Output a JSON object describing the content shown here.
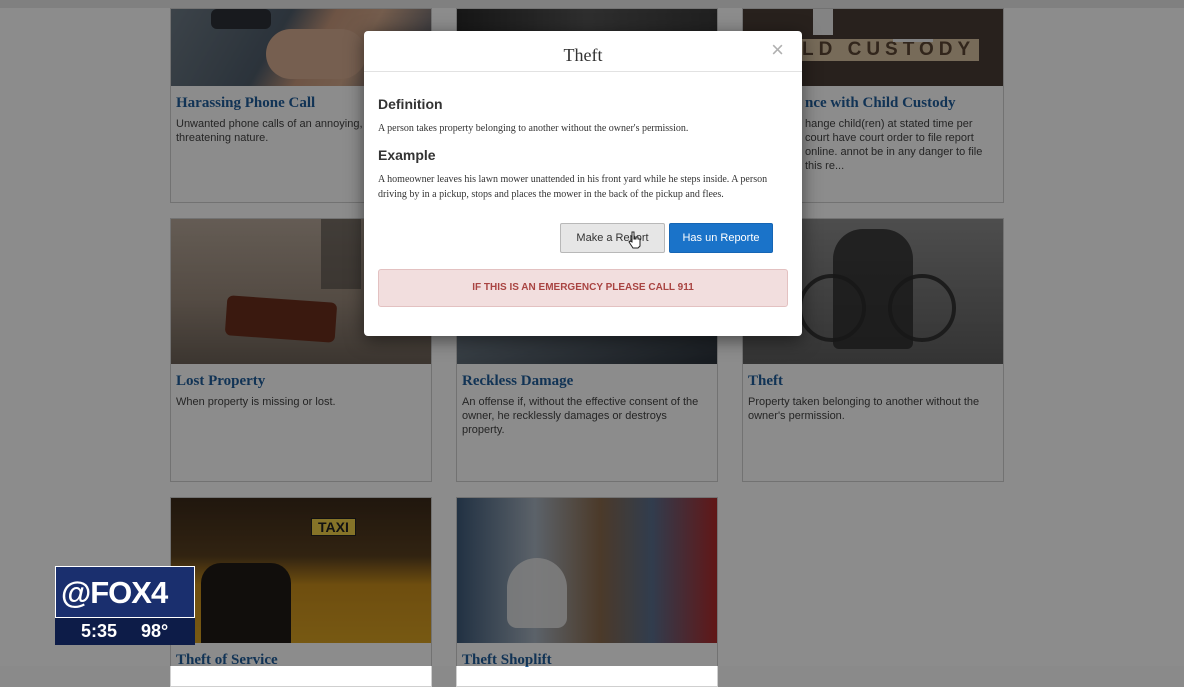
{
  "cards": [
    {
      "title": "Harassing Phone Call",
      "desc": "Unwanted phone calls of an annoying, h threatening nature."
    },
    {
      "title": "",
      "desc": ""
    },
    {
      "title": "nce with Child Custody",
      "desc": "hange child(ren) at stated time per court have court order to file report online. annot be in any danger to file this re..."
    },
    {
      "title": "Lost Property",
      "desc": "When property is missing or lost."
    },
    {
      "title": "Reckless Damage",
      "desc": "An offense if, without the effective consent of the owner, he recklessly damages or destroys property."
    },
    {
      "title": "Theft",
      "desc": "Property taken belonging to another without the owner's permission."
    },
    {
      "title": "Theft of Service",
      "desc": ""
    },
    {
      "title": "Theft Shoplift",
      "desc": ""
    }
  ],
  "image_text": {
    "custody_banner": "LD CUSTODY",
    "taxi_sign": "TAXI"
  },
  "modal": {
    "title": "Theft",
    "close": "×",
    "definition_heading": "Definition",
    "definition_text": "A person takes property belonging to another without the owner's permission.",
    "example_heading": "Example",
    "example_text": "A homeowner leaves his lawn mower unattended in his front yard while he steps inside. A person driving by in a pickup, stops and places the mower in the back of the pickup and flees.",
    "report_button": "Make a Report",
    "spanish_button": "Has un Reporte",
    "emergency_notice": "IF THIS IS AN EMERGENCY PLEASE CALL 911"
  },
  "badge": {
    "logo": "@FOX4",
    "time": "5:35",
    "temperature": "98°"
  }
}
